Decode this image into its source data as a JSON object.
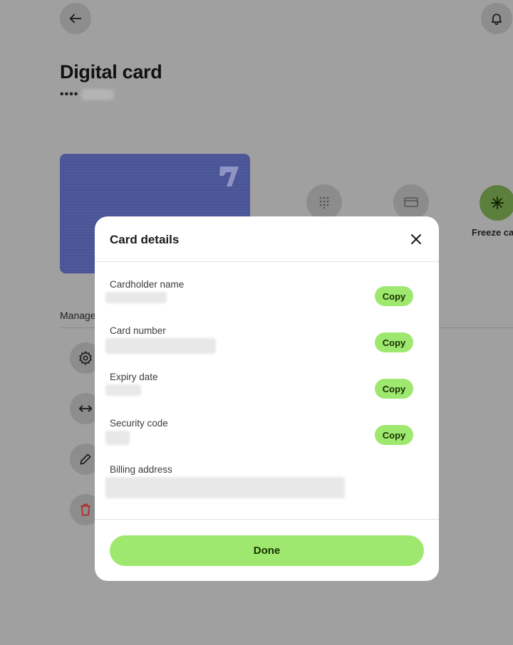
{
  "page": {
    "title": "Digital card",
    "card_mask": "••••",
    "manage_label": "Manage",
    "actions": {
      "freeze_label": "Freeze ca"
    }
  },
  "modal": {
    "title": "Card details",
    "fields": [
      {
        "label": "Cardholder name",
        "copy_label": "Copy"
      },
      {
        "label": "Card number",
        "copy_label": "Copy"
      },
      {
        "label": "Expiry date",
        "copy_label": "Copy"
      },
      {
        "label": "Security code",
        "copy_label": "Copy"
      },
      {
        "label": "Billing address"
      }
    ],
    "done_label": "Done"
  },
  "colors": {
    "accent": "#9fe870",
    "accent_text": "#163300",
    "card": "#4a5494",
    "overlay": "#a0a0a0",
    "danger": "#b02a2a"
  },
  "icons": {
    "back": "arrow-left-icon",
    "bell": "bell-icon",
    "pin": "keypad-icon",
    "card": "card-icon",
    "freeze": "snowflake-icon",
    "settings": "gear-icon",
    "transfer": "arrows-horizontal-icon",
    "edit": "pencil-icon",
    "delete": "trash-icon",
    "close": "close-icon"
  }
}
